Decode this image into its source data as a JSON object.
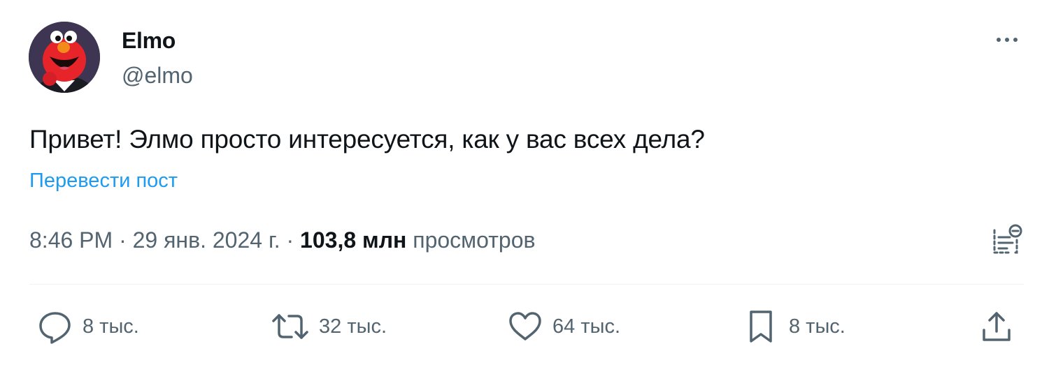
{
  "author": {
    "display_name": "Elmo",
    "handle": "@elmo"
  },
  "tweet": {
    "text": "Привет! Элмо просто интересуется, как у вас всех дела?",
    "translate_label": "Перевести пост"
  },
  "meta": {
    "time": "8:46 PM",
    "separator": "·",
    "date": "29 янв. 2024 г.",
    "views_count": "103,8 млн",
    "views_label": "просмотров"
  },
  "actions": {
    "replies": "8 тыс.",
    "reposts": "32 тыс.",
    "likes": "64 тыс.",
    "bookmarks": "8 тыс."
  },
  "icons": {
    "more": "more-dots-icon",
    "analytics": "analytics-icon",
    "reply": "reply-icon",
    "repost": "repost-icon",
    "like": "heart-icon",
    "bookmark": "bookmark-icon",
    "share": "share-icon"
  },
  "colors": {
    "link": "#1d9bf0",
    "secondary_text": "#536471",
    "primary_text": "#0f1419",
    "divider": "#eff3f4"
  }
}
